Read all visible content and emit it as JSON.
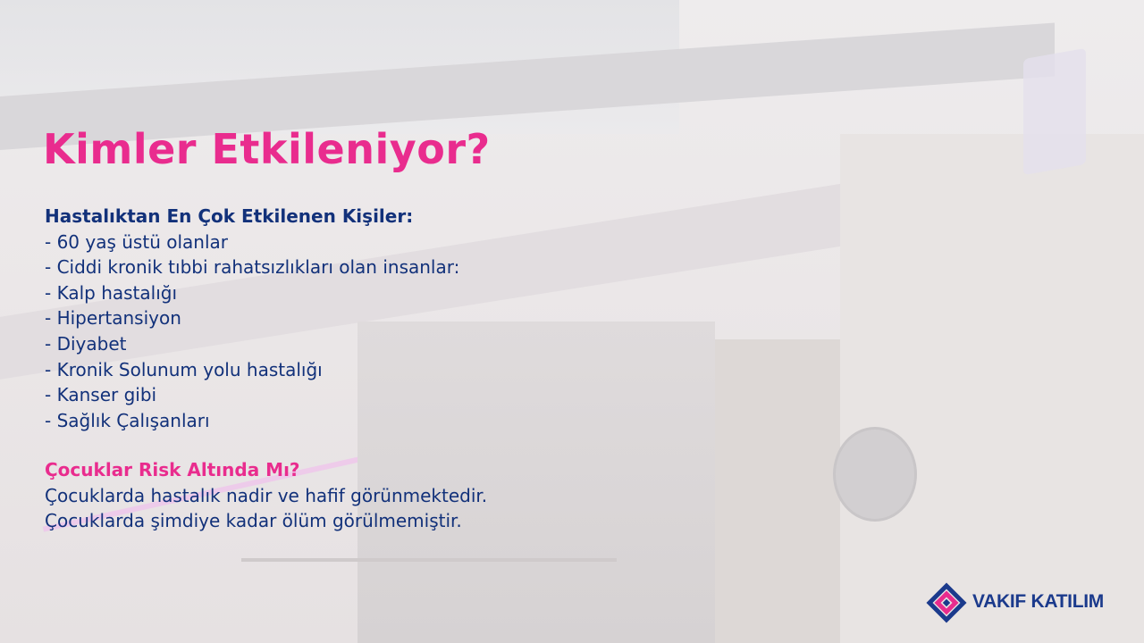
{
  "slide": {
    "title": "Kimler Etkileniyor?",
    "affected_heading": "Hastalıktan En Çok Etkilenen Kişiler:",
    "affected_items": [
      "- 60 yaş üstü olanlar",
      "- Ciddi kronik tıbbi rahatsızlıkları olan insanlar:",
      "- Kalp hastalığı",
      "- Hipertansiyon",
      "- Diyabet",
      "- Kronik Solunum yolu hastalığı",
      "- Kanser gibi",
      "- Sağlık Çalışanları"
    ],
    "children_heading": "Çocuklar Risk Altında Mı?",
    "children_lines": [
      "Çocuklarda hastalık nadir ve hafif görünmektedir.",
      "Çocuklarda şimdiye kadar ölüm görülmemiştir."
    ]
  },
  "brand": {
    "name": "VAKIF KATILIM",
    "logo_icon": "vakif-katilim-logo-mark",
    "colors": {
      "pink": "#e92c8e",
      "navy": "#12317a",
      "brand_blue": "#1b3a8c"
    }
  }
}
